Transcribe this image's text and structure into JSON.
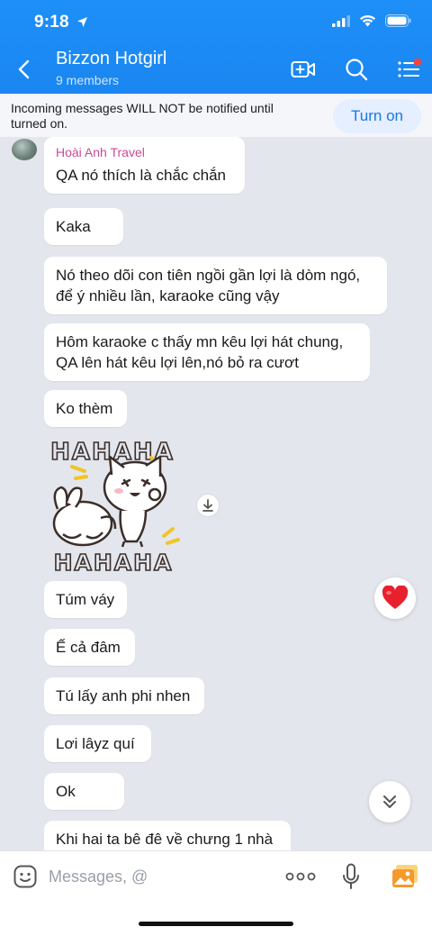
{
  "status": {
    "time": "9:18"
  },
  "header": {
    "title": "Bizzon Hotgirl",
    "subtitle": "9 members"
  },
  "notice": {
    "text": "Incoming messages WILL NOT be notified until turned on.",
    "button": "Turn on"
  },
  "messages": [
    {
      "sender": "Hoài Anh Travel",
      "text": "QA nó thích là chắc chắn"
    },
    {
      "text": "Kaka"
    },
    {
      "text": "Nó theo dõi con tiên ngồi gần lợi là dòm ngó, để ý nhiều lần, karaoke cũng vậy"
    },
    {
      "text": "Hôm karaoke c thấy mn kêu lợi hát chung, QA lên hát kêu lợi lên,nó bỏ ra cươt"
    },
    {
      "text": "Ko thèm"
    },
    {
      "text": "Túm váy"
    },
    {
      "text": "Ế cả đâm"
    },
    {
      "text": "Tú lấy anh phi nhen"
    },
    {
      "text": "Lơi lâyz quí"
    },
    {
      "text": "Ok"
    },
    {
      "text": "Khi hai ta bê đê về chưng 1 nhà"
    }
  ],
  "sticker": {
    "top_text": "HAHAHA",
    "bottom_text": "HAHAHA"
  },
  "input": {
    "placeholder": "Messages, @"
  },
  "colors": {
    "header": "#1a86f1",
    "accent": "#1a78e6",
    "sender": "#c94a93",
    "heart": "#e8202e"
  }
}
